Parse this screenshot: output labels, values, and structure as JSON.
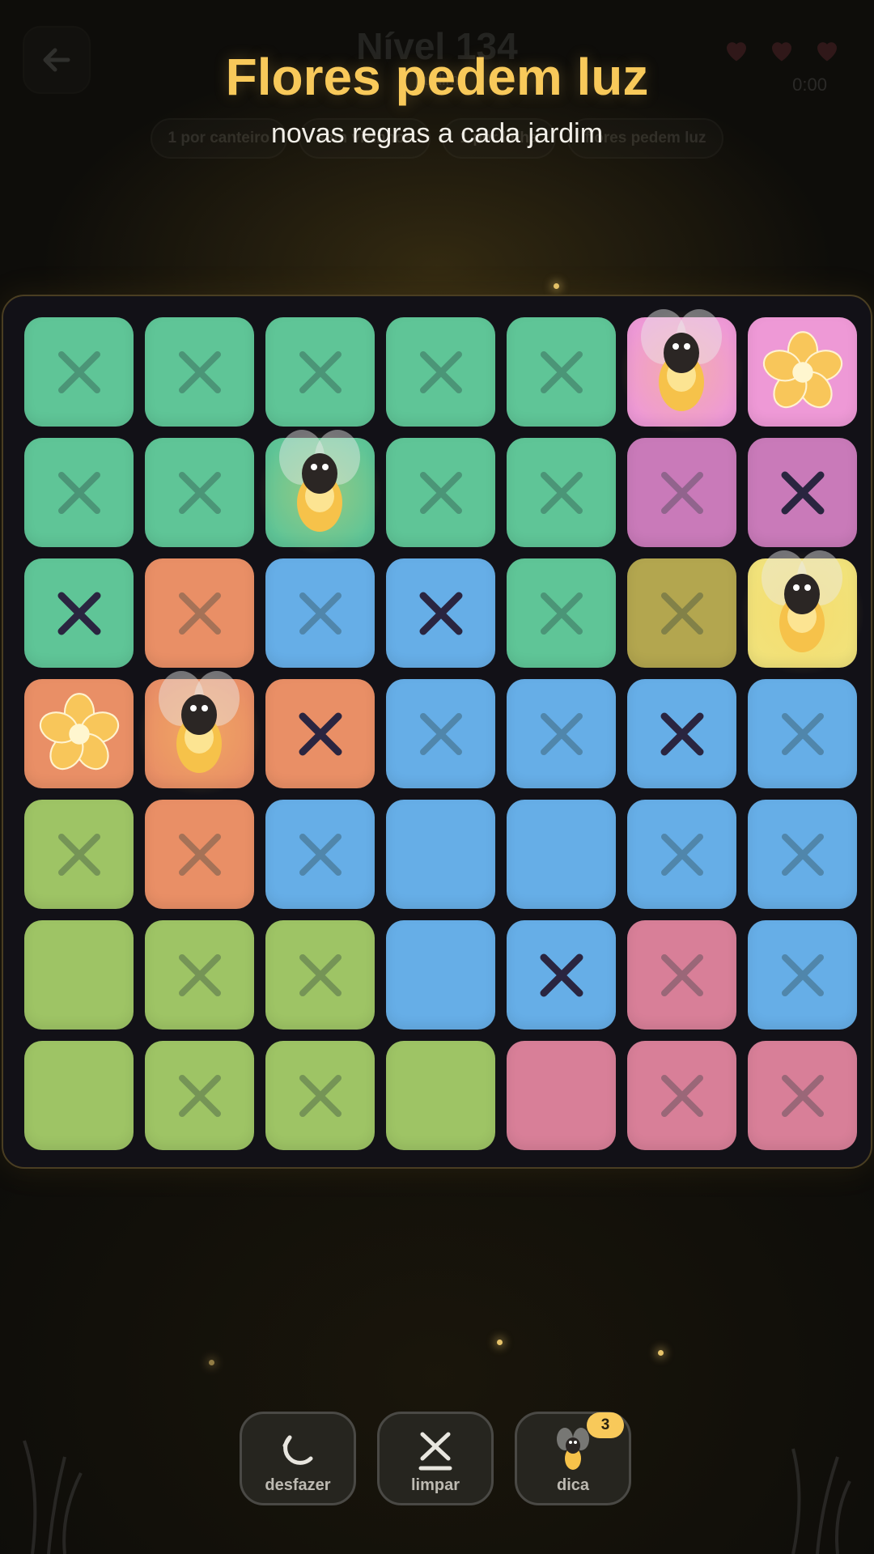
{
  "header": {
    "level_title": "Nível 134",
    "level_subtitle": "jardim",
    "timer": "0:00",
    "lives": 3,
    "chips": [
      "1 por canteiro",
      "sem vizinhos",
      "1 por linha",
      "flores pedem luz"
    ]
  },
  "overlay": {
    "title": "Flores pedem luz",
    "subtitle": "novas regras a cada jardim"
  },
  "colors": {
    "green": "#5fc597",
    "pink": "#ee99d6",
    "magenta": "#c97ab9",
    "orange": "#e98f66",
    "blue": "#66aee7",
    "olive": "#b3a64f",
    "yellow": "#f1e27a",
    "lime": "#9ec465",
    "rose": "#d87f98",
    "accent": "#f8c95a"
  },
  "board": {
    "rows": [
      [
        {
          "region": "green",
          "state": "x"
        },
        {
          "region": "green",
          "state": "x"
        },
        {
          "region": "green",
          "state": "x"
        },
        {
          "region": "green",
          "state": "x"
        },
        {
          "region": "green",
          "state": "x"
        },
        {
          "region": "pink",
          "state": "firefly"
        },
        {
          "region": "pink",
          "state": "flower"
        }
      ],
      [
        {
          "region": "green",
          "state": "x"
        },
        {
          "region": "green",
          "state": "x"
        },
        {
          "region": "green",
          "state": "firefly"
        },
        {
          "region": "green",
          "state": "x"
        },
        {
          "region": "green",
          "state": "x"
        },
        {
          "region": "magenta",
          "state": "x"
        },
        {
          "region": "magenta",
          "state": "X"
        }
      ],
      [
        {
          "region": "green",
          "state": "X"
        },
        {
          "region": "orange",
          "state": "x"
        },
        {
          "region": "blue",
          "state": "x"
        },
        {
          "region": "blue",
          "state": "X"
        },
        {
          "region": "green",
          "state": "x"
        },
        {
          "region": "olive",
          "state": "x"
        },
        {
          "region": "yellow",
          "state": "firefly"
        }
      ],
      [
        {
          "region": "orange",
          "state": "flower"
        },
        {
          "region": "orange",
          "state": "firefly"
        },
        {
          "region": "orange",
          "state": "X"
        },
        {
          "region": "blue",
          "state": "x"
        },
        {
          "region": "blue",
          "state": "x"
        },
        {
          "region": "blue",
          "state": "X"
        },
        {
          "region": "blue",
          "state": "x"
        }
      ],
      [
        {
          "region": "lime",
          "state": "x"
        },
        {
          "region": "orange",
          "state": "x"
        },
        {
          "region": "blue",
          "state": "x"
        },
        {
          "region": "blue",
          "state": "empty"
        },
        {
          "region": "blue",
          "state": "empty"
        },
        {
          "region": "blue",
          "state": "x"
        },
        {
          "region": "blue",
          "state": "x"
        }
      ],
      [
        {
          "region": "lime",
          "state": "empty"
        },
        {
          "region": "lime",
          "state": "x"
        },
        {
          "region": "lime",
          "state": "x"
        },
        {
          "region": "blue",
          "state": "empty"
        },
        {
          "region": "blue",
          "state": "X"
        },
        {
          "region": "rose",
          "state": "x"
        },
        {
          "region": "blue",
          "state": "x"
        }
      ],
      [
        {
          "region": "lime",
          "state": "empty"
        },
        {
          "region": "lime",
          "state": "x"
        },
        {
          "region": "lime",
          "state": "x"
        },
        {
          "region": "lime",
          "state": "empty"
        },
        {
          "region": "rose",
          "state": "empty"
        },
        {
          "region": "rose",
          "state": "x"
        },
        {
          "region": "rose",
          "state": "x"
        }
      ]
    ]
  },
  "controls": {
    "undo_label": "desfazer",
    "clear_label": "limpar",
    "hint_label": "dica",
    "hint_count": "3"
  }
}
